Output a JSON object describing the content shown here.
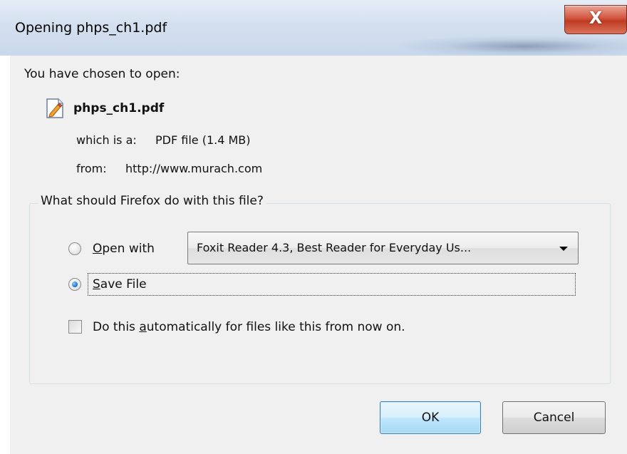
{
  "window": {
    "title": "Opening phps_ch1.pdf",
    "close_glyph": "X"
  },
  "info": {
    "chosen_label": "You have chosen to open:",
    "file_icon": "pdf-document-icon",
    "file_name": "phps_ch1.pdf",
    "which_label": "which is a:",
    "which_value": "PDF file (1.4 MB)",
    "from_label": "from:",
    "from_value": "http://www.murach.com"
  },
  "action": {
    "legend": "What should Firefox do with this file?",
    "open_with_label_prefix": "",
    "open_with_accel": "O",
    "open_with_rest": "pen with",
    "open_with_selected_app": "Foxit Reader 4.3, Best Reader for Everyday Us...",
    "save_accel": "S",
    "save_rest": "ave File",
    "selected_option": "save_file",
    "auto_prefix": "Do this ",
    "auto_accel": "a",
    "auto_rest": "utomatically for files like this from now on.",
    "auto_checked": false
  },
  "buttons": {
    "ok": "OK",
    "cancel": "Cancel"
  },
  "colors": {
    "titlebar": "#d4e0ef",
    "client": "#f0f0f0",
    "close_button": "#c03a22",
    "default_button_border": "#3c7fb1"
  }
}
